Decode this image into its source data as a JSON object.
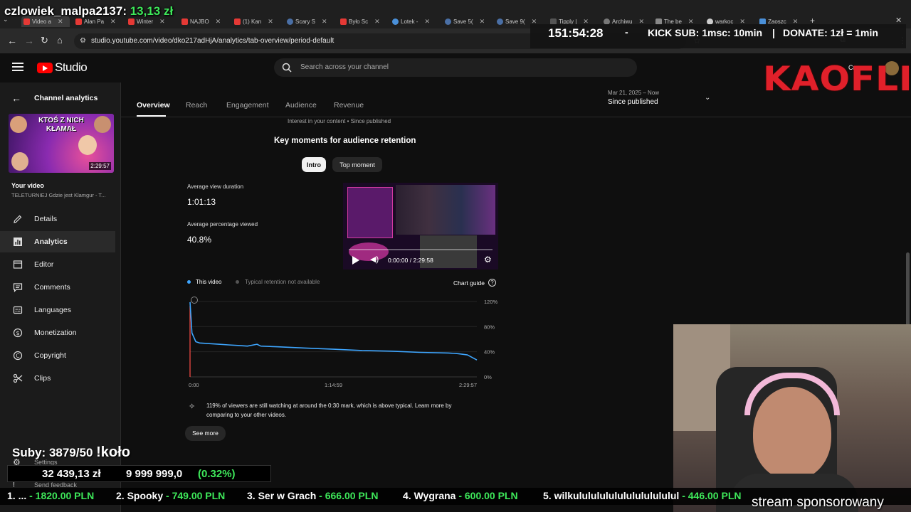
{
  "browser": {
    "tabs": [
      {
        "label": "Video a"
      },
      {
        "label": "Alan Pa"
      },
      {
        "label": "Winter"
      },
      {
        "label": "NAJBO"
      },
      {
        "label": "(1) Kan"
      },
      {
        "label": "Scary S"
      },
      {
        "label": "Było Sc"
      },
      {
        "label": "Lotek -"
      },
      {
        "label": "Save 5("
      },
      {
        "label": "Save 9("
      },
      {
        "label": "Tipply |"
      },
      {
        "label": "Archiwu"
      },
      {
        "label": "The be"
      },
      {
        "label": "warkoc"
      },
      {
        "label": "Zaoszc"
      }
    ],
    "url": "studio.youtube.com/video/dko217adHjA/analytics/tab-overview/period-default"
  },
  "overlays": {
    "user_name": "czlowiek_malpa2137:",
    "user_amount": "13,13 zł",
    "timer": "151:54:28",
    "sep1": "-",
    "kick_sub": "KICK SUB: 1msc: 10min",
    "sep2": "|",
    "donate": "DONATE: 1zł = 1min",
    "brand_logo": "KAOFLIX",
    "subs": "Suby: 3879/50",
    "wheel": "!koło",
    "goal_amount": "32 439,13 zł",
    "goal_target": "9 999 999,0",
    "goal_pct": "(0.32%)",
    "stream_text": "stream sponsorowany",
    "leaderboard": [
      {
        "rank": "1. ...",
        "amount": "- 1820.00 PLN"
      },
      {
        "rank": "2. Spooky",
        "amount": "- 749.00 PLN"
      },
      {
        "rank": "3. Ser w Grach",
        "amount": "- 666.00 PLN"
      },
      {
        "rank": "4. Wygrana",
        "amount": "- 600.00 PLN"
      },
      {
        "rank": "5. wilkulululululululululululul",
        "amount": "- 446.00 PLN"
      }
    ]
  },
  "studio": {
    "logo_text": "Studio",
    "search_placeholder": "Search across your channel",
    "header_right": "Cr"
  },
  "sidebar": {
    "back_label": "Channel analytics",
    "thumb_title_line1": "KTOŚ Z NICH",
    "thumb_title_line2": "KŁAMAŁ",
    "thumb_duration": "2:29:57",
    "your_video": "Your video",
    "video_title": "TELETURNIEJ Gdzie jest Klamgur - T...",
    "items": [
      {
        "label": "Details",
        "icon": "pencil-icon"
      },
      {
        "label": "Analytics",
        "icon": "analytics-icon"
      },
      {
        "label": "Editor",
        "icon": "editor-icon"
      },
      {
        "label": "Comments",
        "icon": "comments-icon"
      },
      {
        "label": "Languages",
        "icon": "languages-icon"
      },
      {
        "label": "Monetization",
        "icon": "monetization-icon"
      },
      {
        "label": "Copyright",
        "icon": "copyright-icon"
      },
      {
        "label": "Clips",
        "icon": "scissors-icon"
      }
    ],
    "settings": "Settings",
    "send_feedback": "Send feedback"
  },
  "tabs": [
    {
      "label": "Overview"
    },
    {
      "label": "Reach"
    },
    {
      "label": "Engagement"
    },
    {
      "label": "Audience"
    },
    {
      "label": "Revenue"
    }
  ],
  "period": {
    "range": "Mar 21, 2025 – Now",
    "label": "Since published"
  },
  "retention": {
    "subtitle": "Interest in your content • Since published",
    "title": "Key moments for audience retention",
    "chip_intro": "Intro",
    "chip_top": "Top moment",
    "avg_duration_label": "Average view duration",
    "avg_duration_value": "1:01:13",
    "avg_pct_label": "Average percentage viewed",
    "avg_pct_value": "40.8%",
    "player_time": "0:00:00 / 2:29:58",
    "legend_this": "This video",
    "legend_typical": "Typical retention not available",
    "chart_guide": "Chart guide",
    "insight": "119% of viewers are still watching at around the 0:30 mark, which is above typical. Learn more by comparing to your other videos.",
    "see_more": "See more"
  },
  "chart_data": {
    "type": "line",
    "title": "",
    "xlabel": "",
    "ylabel": "",
    "x_ticks": [
      "0:00",
      "1:14:59",
      "2:29:57"
    ],
    "y_ticks": [
      "0%",
      "40%",
      "80%",
      "120%"
    ],
    "ylim": [
      0,
      120
    ],
    "xlim_minutes": [
      0,
      149.95
    ],
    "series": [
      {
        "color": "#3ea6ff",
        "points": [
          [
            0,
            119
          ],
          [
            1,
            70
          ],
          [
            3,
            56
          ],
          [
            5,
            54
          ],
          [
            10,
            53
          ],
          [
            15,
            52
          ],
          [
            20,
            51
          ],
          [
            25,
            50
          ],
          [
            30,
            49
          ],
          [
            35,
            52
          ],
          [
            37,
            49
          ],
          [
            45,
            48
          ],
          [
            60,
            46
          ],
          [
            75,
            44
          ],
          [
            90,
            42
          ],
          [
            105,
            41
          ],
          [
            120,
            39
          ],
          [
            135,
            38
          ],
          [
            140,
            37
          ],
          [
            145,
            35
          ],
          [
            149.95,
            27
          ]
        ]
      }
    ],
    "grid": true,
    "colors": {
      "line": "#3ea6ff",
      "red_marker": "#ff4e45"
    }
  }
}
